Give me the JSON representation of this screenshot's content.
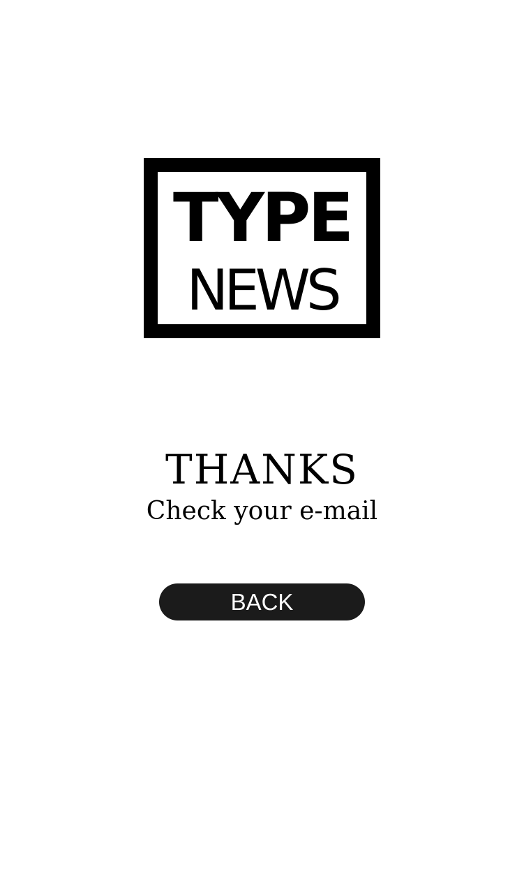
{
  "logo": {
    "line1": "TYPE",
    "line2": "NEWS"
  },
  "message": {
    "title": "THANKS",
    "subtitle": "Check your e-mail"
  },
  "actions": {
    "back_label": "BACK"
  },
  "colors": {
    "background": "#ffffff",
    "logo": "#000000",
    "button_bg": "#1b1b1b",
    "button_text": "#ffffff"
  }
}
